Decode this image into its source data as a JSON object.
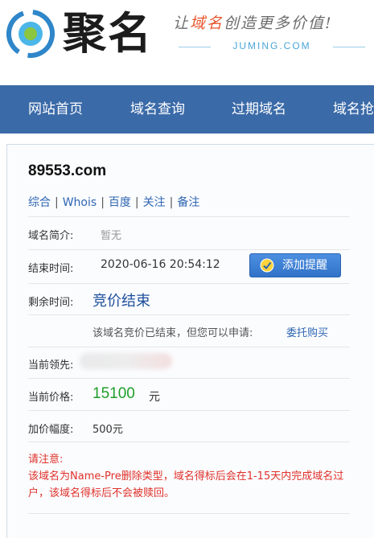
{
  "header": {
    "logo_text": "聚名",
    "slogan_prefix": "让",
    "slogan_highlight": "域名",
    "slogan_suffix": "创造更多价值!",
    "site_url": "JUMING.COM"
  },
  "nav": {
    "items": [
      {
        "label": "网站首页"
      },
      {
        "label": "域名查询"
      },
      {
        "label": "过期域名"
      },
      {
        "label": "域名抢"
      }
    ]
  },
  "domain": {
    "name": "89553.com",
    "links": [
      "综合",
      "Whois",
      "百度",
      "关注",
      "备注"
    ],
    "intro_label": "域名简介:",
    "intro_value": "暂无",
    "end_label": "结束时间:",
    "end_value": "2020-06-16 20:54:12",
    "remind_button": "添加提醒",
    "remain_label": "剩余时间:",
    "remain_value": "竞价结束",
    "ended_note": "该域名竞价已结束，但您可以申请:",
    "ended_link": "委托购买",
    "leader_label": "当前领先:",
    "price_label": "当前价格:",
    "price_value": "15100",
    "price_unit": "元",
    "increment_label": "加价幅度:",
    "increment_value": "500元"
  },
  "notice": {
    "title": "请注意:",
    "body": "该域名为Name-Pre删除类型，域名得标后会在1-15天内完成域名过户，该域名得标后不会被赎回。"
  },
  "colors": {
    "nav_bg": "#3a6aa8",
    "link": "#2f66b3",
    "price": "#1f9e2a",
    "notice": "#e0322b",
    "button": "#3173c8"
  }
}
